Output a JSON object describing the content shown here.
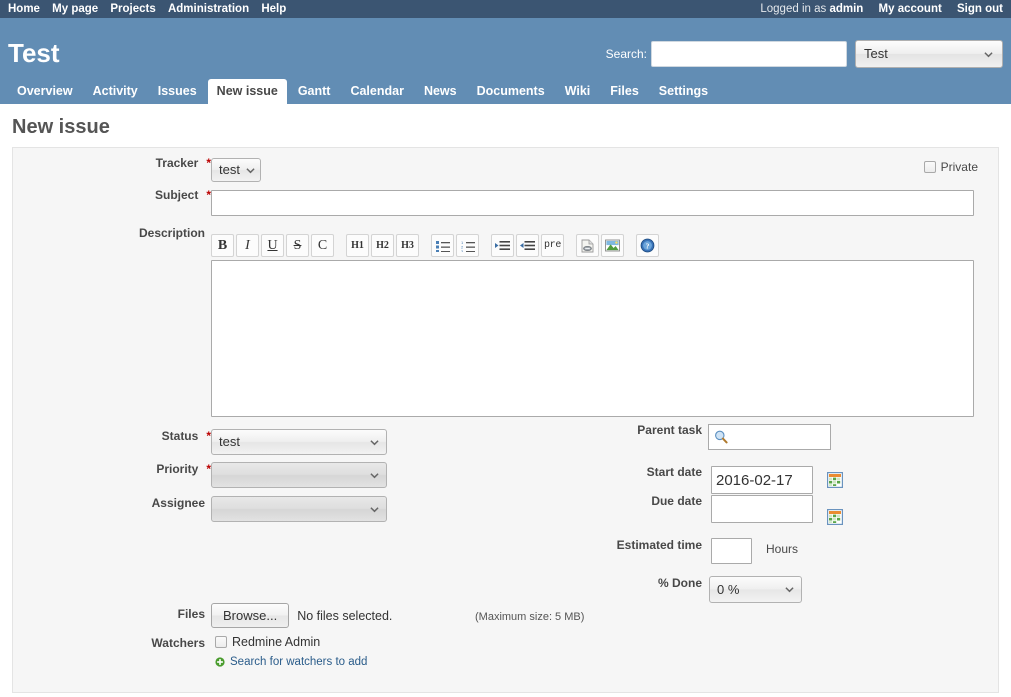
{
  "top_menu": {
    "left_links": [
      {
        "label": "Home",
        "name": "home"
      },
      {
        "label": "My page",
        "name": "my-page"
      },
      {
        "label": "Projects",
        "name": "projects"
      },
      {
        "label": "Administration",
        "name": "administration"
      },
      {
        "label": "Help",
        "name": "help"
      }
    ],
    "logged_in_prefix": "Logged in as",
    "username": "admin",
    "my_account": "My account",
    "sign_out": "Sign out"
  },
  "header": {
    "project_title": "Test",
    "search_label": "Search:",
    "search_value": "",
    "project_select_value": "Test"
  },
  "main_menu": {
    "items": [
      {
        "label": "Overview",
        "selected": false
      },
      {
        "label": "Activity",
        "selected": false
      },
      {
        "label": "Issues",
        "selected": false
      },
      {
        "label": "New issue",
        "selected": true
      },
      {
        "label": "Gantt",
        "selected": false
      },
      {
        "label": "Calendar",
        "selected": false
      },
      {
        "label": "News",
        "selected": false
      },
      {
        "label": "Documents",
        "selected": false
      },
      {
        "label": "Wiki",
        "selected": false
      },
      {
        "label": "Files",
        "selected": false
      },
      {
        "label": "Settings",
        "selected": false
      }
    ]
  },
  "page": {
    "title": "New issue"
  },
  "form": {
    "private_label": "Private",
    "private_checked": false,
    "tracker": {
      "label": "Tracker",
      "required": true,
      "value": "test"
    },
    "subject": {
      "label": "Subject",
      "required": true,
      "value": "",
      "placeholder": ""
    },
    "description": {
      "label": "Description",
      "value": "",
      "placeholder": ""
    },
    "toolbar": [
      {
        "name": "bold",
        "glyph": "B",
        "cls": "b"
      },
      {
        "name": "italic",
        "glyph": "I",
        "cls": "i"
      },
      {
        "name": "underline",
        "glyph": "U",
        "cls": "u"
      },
      {
        "name": "strikethrough",
        "glyph": "S",
        "cls": "s"
      },
      {
        "name": "code",
        "glyph": "C",
        "cls": "c"
      },
      {
        "name": "heading-1",
        "glyph": "H1",
        "cls": "h gap"
      },
      {
        "name": "heading-2",
        "glyph": "H2",
        "cls": "h"
      },
      {
        "name": "heading-3",
        "glyph": "H3",
        "cls": "h"
      },
      {
        "name": "unordered-list",
        "glyph": "",
        "cls": "gap"
      },
      {
        "name": "ordered-list",
        "glyph": "",
        "cls": ""
      },
      {
        "name": "indent-increase",
        "glyph": "",
        "cls": "gap"
      },
      {
        "name": "indent-decrease",
        "glyph": "",
        "cls": ""
      },
      {
        "name": "preformatted",
        "glyph": "pre",
        "cls": "pre"
      },
      {
        "name": "insert-link",
        "glyph": "",
        "cls": "gap"
      },
      {
        "name": "insert-image",
        "glyph": "",
        "cls": ""
      },
      {
        "name": "help",
        "glyph": "",
        "cls": "gap"
      }
    ],
    "status": {
      "label": "Status",
      "required": true,
      "value": "test"
    },
    "priority": {
      "label": "Priority",
      "required": true,
      "value": ""
    },
    "assignee": {
      "label": "Assignee",
      "required": false,
      "value": ""
    },
    "parent_task": {
      "label": "Parent task",
      "value": "",
      "icon": "magnifier-icon"
    },
    "start_date": {
      "label": "Start date",
      "value": "2016-02-17"
    },
    "due_date": {
      "label": "Due date",
      "value": ""
    },
    "estimated_time": {
      "label": "Estimated time",
      "value": "",
      "unit": "Hours"
    },
    "percent_done": {
      "label": "% Done",
      "value": "0 %"
    },
    "files": {
      "label": "Files",
      "browse_label": "Browse...",
      "no_files_text": "No files selected.",
      "max_size_text": "(Maximum size: 5 MB)"
    },
    "watchers": {
      "label": "Watchers",
      "items": [
        {
          "name": "Redmine Admin",
          "checked": false
        }
      ],
      "search_link": "Search for watchers to add"
    }
  },
  "colors": {
    "top_bar": "#3b5572",
    "header": "#628db4",
    "form_bg": "#f6f6f6",
    "required_star": "#bb0000",
    "link": "#2a5c8a"
  }
}
